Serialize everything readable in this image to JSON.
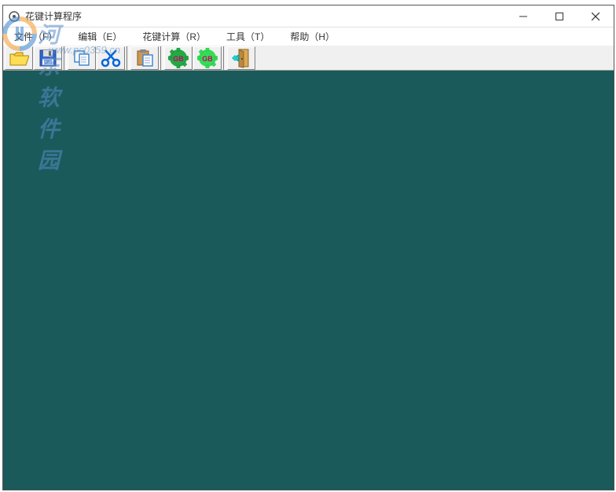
{
  "window": {
    "title": "花键计算程序"
  },
  "menu": {
    "file": "文件（F）",
    "edit": "编辑（E）",
    "calc": "花键计算（R）",
    "tools": "工具（T）",
    "help": "帮助（H）"
  },
  "toolbar": {
    "open": "open",
    "save": "save",
    "copy": "copy",
    "cut": "cut",
    "paste": "paste",
    "gb1": "GB",
    "gb2": "GB",
    "exit": "exit"
  },
  "watermark": {
    "text": "河东软件园",
    "url": "www.pc0359.cn"
  }
}
